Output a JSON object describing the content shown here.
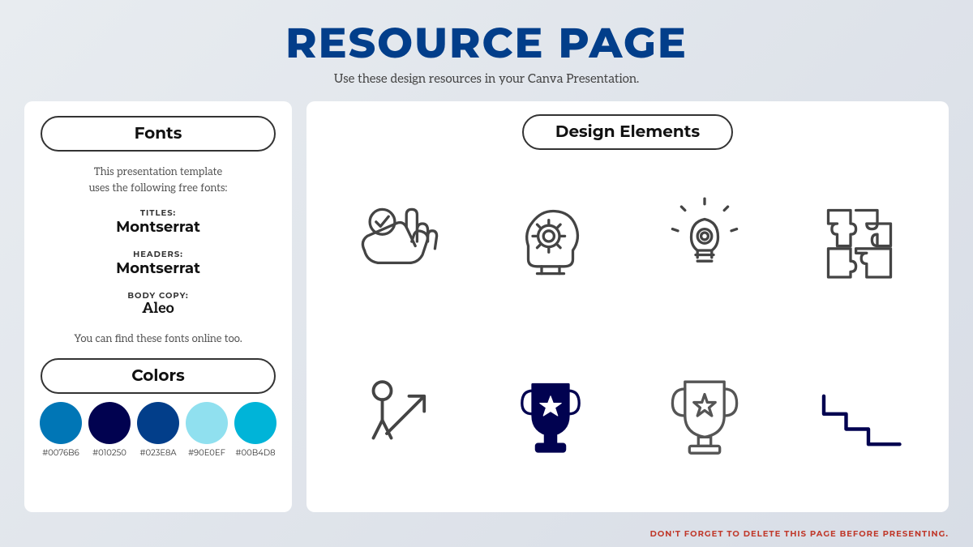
{
  "header": {
    "title": "RESOURCE PAGE",
    "subtitle": "Use these design resources in your Canva Presentation."
  },
  "left_panel": {
    "fonts_section": {
      "label": "Fonts",
      "description_line1": "This presentation template",
      "description_line2": "uses the following free fonts:",
      "items": [
        {
          "label": "TITLES:",
          "name": "Montserrat",
          "type": "montserrat"
        },
        {
          "label": "HEADERS:",
          "name": "Montserrat",
          "type": "montserrat"
        },
        {
          "label": "BODY COPY:",
          "name": "Aleo",
          "type": "aleo"
        }
      ],
      "note": "You can find these fonts online too."
    },
    "colors_section": {
      "label": "Colors",
      "swatches": [
        {
          "hex": "#0076B6",
          "label": "#0076B6"
        },
        {
          "hex": "#010250",
          "label": "#010250"
        },
        {
          "hex": "#023E8A",
          "label": "#023E8A"
        },
        {
          "hex": "#90E0EF",
          "label": "#90E0EF"
        },
        {
          "hex": "#00B4D8",
          "label": "#00B4D8"
        }
      ]
    }
  },
  "right_panel": {
    "label": "Design Elements"
  },
  "footer": {
    "text": "DON'T FORGET TO DELETE THIS PAGE BEFORE PRESENTING."
  }
}
